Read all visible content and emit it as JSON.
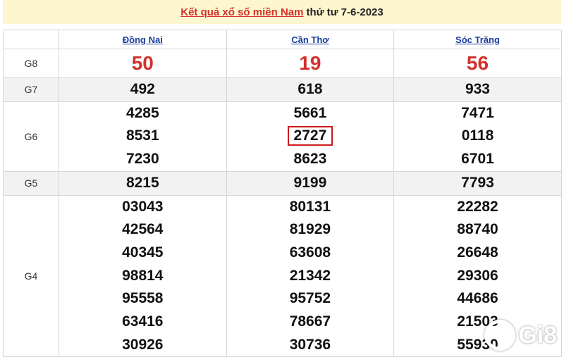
{
  "header": {
    "title_link": "Kết quả xổ số miền Nam",
    "title_date": "thứ tư 7-6-2023"
  },
  "table": {
    "provinces": [
      "Đồng Nai",
      "Cần Thơ",
      "Sóc Trăng"
    ],
    "rows": [
      {
        "label": "G8",
        "shaded": false,
        "big": true,
        "cells": [
          [
            "50"
          ],
          [
            "19"
          ],
          [
            "56"
          ]
        ]
      },
      {
        "label": "G7",
        "shaded": true,
        "cells": [
          [
            "492"
          ],
          [
            "618"
          ],
          [
            "933"
          ]
        ]
      },
      {
        "label": "G6",
        "shaded": false,
        "cells": [
          [
            "4285",
            "8531",
            "7230"
          ],
          [
            "5661",
            "2727",
            "8623"
          ],
          [
            "7471",
            "0118",
            "6701"
          ]
        ]
      },
      {
        "label": "G5",
        "shaded": true,
        "cells": [
          [
            "8215"
          ],
          [
            "9199"
          ],
          [
            "7793"
          ]
        ]
      },
      {
        "label": "G4",
        "shaded": false,
        "cells": [
          [
            "03043",
            "42564",
            "40345",
            "98814",
            "95558",
            "63416",
            "30926"
          ],
          [
            "80131",
            "81929",
            "63608",
            "21342",
            "95752",
            "78667",
            "30736"
          ],
          [
            "22282",
            "88740",
            "26648",
            "29306",
            "44686",
            "21503",
            "55930"
          ]
        ]
      }
    ],
    "highlighted": {
      "row": 2,
      "col": 1,
      "index": 1,
      "color": "#cc1c1c"
    }
  },
  "watermark": {
    "text": "Gi8"
  },
  "colors": {
    "accent": "#d2312c",
    "link": "#1a3d9a",
    "title_bg": "#fdf6cf",
    "row_shade": "#f2f2f2"
  }
}
